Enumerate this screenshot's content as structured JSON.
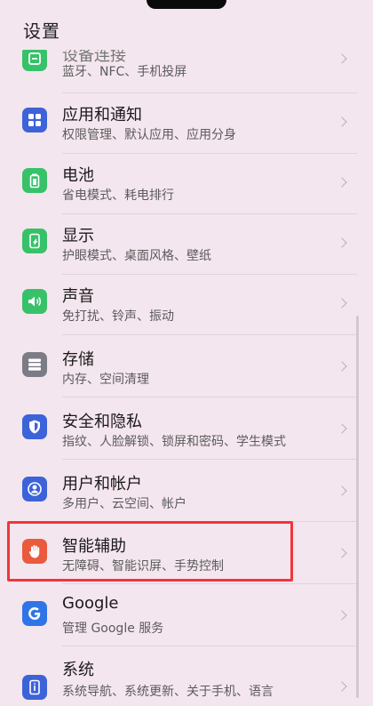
{
  "header": {
    "title": "设置"
  },
  "colors": {
    "accent_highlight": "#f2353a",
    "icon_green": "#37c26a",
    "icon_blue": "#3d63d8",
    "icon_gray": "#7c7c87",
    "icon_red": "#ea5a3c",
    "icon_google": "#2f75e8"
  },
  "items": [
    {
      "title": "设备连接",
      "subtitle": "蓝牙、NFC、手机投屏",
      "icon": "device-connect-icon"
    },
    {
      "title": "应用和通知",
      "subtitle": "权限管理、默认应用、应用分身",
      "icon": "apps-grid-icon"
    },
    {
      "title": "电池",
      "subtitle": "省电模式、耗电排行",
      "icon": "battery-icon"
    },
    {
      "title": "显示",
      "subtitle": "护眼模式、桌面风格、壁纸",
      "icon": "display-icon"
    },
    {
      "title": "声音",
      "subtitle": "免打扰、铃声、振动",
      "icon": "speaker-icon"
    },
    {
      "title": "存储",
      "subtitle": "内存、空间清理",
      "icon": "storage-icon"
    },
    {
      "title": "安全和隐私",
      "subtitle": "指纹、人脸解锁、锁屏和密码、学生模式",
      "icon": "shield-icon"
    },
    {
      "title": "用户和帐户",
      "subtitle": "多用户、云空间、帐户",
      "icon": "user-icon"
    },
    {
      "title": "智能辅助",
      "subtitle": "无障碍、智能识屏、手势控制",
      "icon": "hand-icon"
    },
    {
      "title": "Google",
      "subtitle": "管理 Google 服务",
      "icon": "google-icon"
    },
    {
      "title": "系统",
      "subtitle": "系统导航、系统更新、关于手机、语言",
      "icon": "system-info-icon"
    }
  ]
}
